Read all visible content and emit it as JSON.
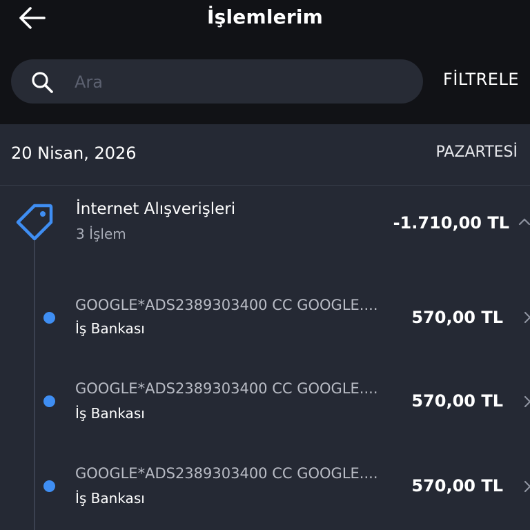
{
  "header": {
    "title": "İşlemlerim",
    "filter_label": "FİLTRELE"
  },
  "search": {
    "placeholder": "Ara",
    "value": ""
  },
  "date_group": {
    "date": "20 Nisan, 2026",
    "weekday": "PAZARTESİ"
  },
  "category": {
    "name": "İnternet Alışverişleri",
    "count_label": "3 İşlem",
    "amount": "-1.710,00 TL",
    "icon": "tag-icon"
  },
  "transactions": [
    {
      "description": "GOOGLE*ADS2389303400 CC GOOGLE....",
      "bank": "İş Bankası",
      "amount": "570,00 TL"
    },
    {
      "description": "GOOGLE*ADS2389303400 CC GOOGLE....",
      "bank": "İş Bankası",
      "amount": "570,00 TL"
    },
    {
      "description": "GOOGLE*ADS2389303400 CC GOOGLE....",
      "bank": "İş Bankası",
      "amount": "570,00 TL"
    }
  ],
  "colors": {
    "background": "#252934",
    "header_background": "#111216",
    "accent": "#3f8ef3"
  }
}
